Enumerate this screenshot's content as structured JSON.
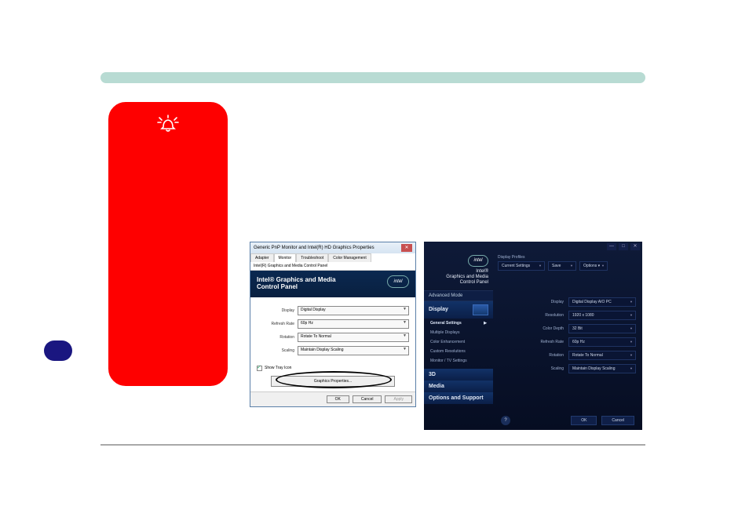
{
  "dialog1": {
    "window_title": "Generic PnP Monitor and Intel(R) HD Graphics Properties",
    "tabs": [
      "Adapter",
      "Monitor",
      "Troubleshoot",
      "Color Management"
    ],
    "subheader": "Intel(R) Graphics and Media Control Panel",
    "hero_line1": "Intel® Graphics and Media",
    "hero_line2": "Control Panel",
    "intel_label": "intel",
    "rows": {
      "display": {
        "label": "Display",
        "value": "Digital Display"
      },
      "refresh": {
        "label": "Refresh Rate",
        "value": "60p Hz"
      },
      "rotation": {
        "label": "Rotation",
        "value": "Rotate To Normal"
      },
      "scaling": {
        "label": "Scaling",
        "value": "Maintain Display Scaling"
      }
    },
    "tray_check_label": "Show Tray Icon",
    "graphics_properties_btn": "Graphics Properties...",
    "footer": {
      "ok": "OK",
      "cancel": "Cancel",
      "apply": "Apply"
    }
  },
  "panel2": {
    "win_min": "—",
    "win_max": "□",
    "win_close": "✕",
    "intel_label": "intel",
    "brand_line1": "Intel®",
    "brand_line2": "Graphics and Media",
    "brand_line3": "Control Panel",
    "profiles_label": "Display Profiles",
    "current_settings": "Current Settings",
    "save": "Save",
    "options": "Options ▾",
    "nav": {
      "advanced_mode": "Advanced Mode",
      "display": "Display",
      "general_settings": "General Settings",
      "multiple_displays": "Multiple Displays",
      "color_enhancement": "Color Enhancement",
      "custom_resolutions": "Custom Resolutions",
      "monitor_tv_settings": "Monitor / TV Settings",
      "threeD": "3D",
      "media": "Media",
      "options_support": "Options and Support",
      "play": "▶"
    },
    "settings": {
      "display": {
        "label": "Display",
        "value": "Digital Display AIO PC"
      },
      "resolution": {
        "label": "Resolution",
        "value": "1920 x 1080"
      },
      "color_depth": {
        "label": "Color Depth",
        "value": "32 Bit"
      },
      "refresh_rate": {
        "label": "Refresh Rate",
        "value": "60p Hz"
      },
      "rotation": {
        "label": "Rotation",
        "value": "Rotate To Normal"
      },
      "scaling": {
        "label": "Scaling",
        "value": "Maintain Display Scaling"
      }
    },
    "footer": {
      "help": "?",
      "ok": "OK",
      "cancel": "Cancel"
    }
  }
}
